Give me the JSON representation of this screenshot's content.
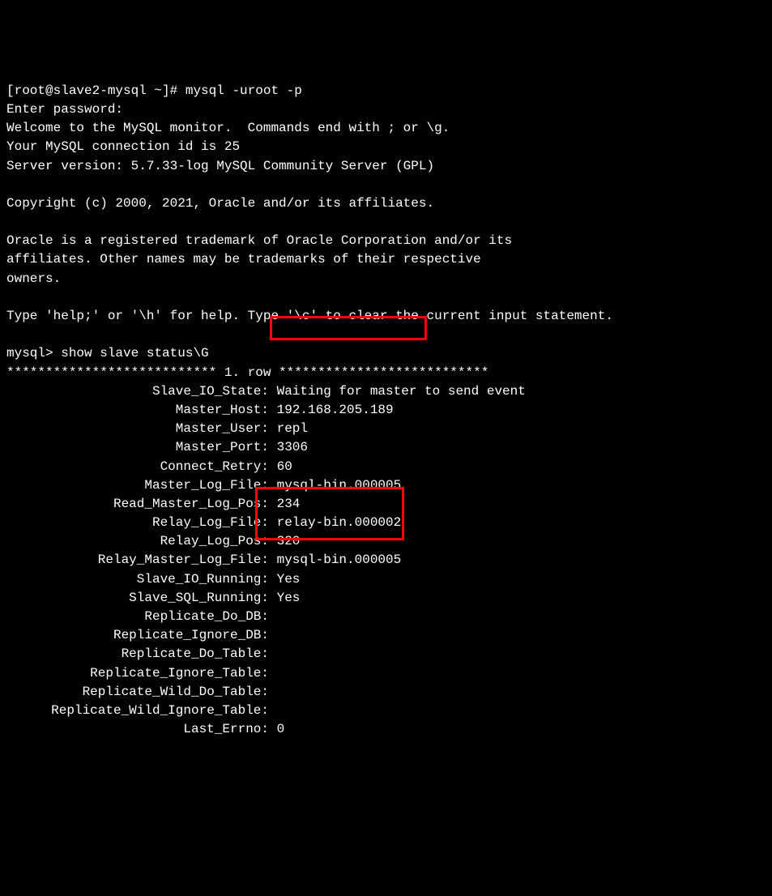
{
  "prompt": "[root@slave2-mysql ~]# ",
  "command": "mysql -uroot -p",
  "intro": {
    "enter_password": "Enter password: ",
    "welcome": "Welcome to the MySQL monitor.  Commands end with ; or \\g.",
    "connection_id": "Your MySQL connection id is 25",
    "server_version": "Server version: 5.7.33-log MySQL Community Server (GPL)",
    "copyright": "Copyright (c) 2000, 2021, Oracle and/or its affiliates.",
    "trademark1": "Oracle is a registered trademark of Oracle Corporation and/or its",
    "trademark2": "affiliates. Other names may be trademarks of their respective",
    "trademark3": "owners.",
    "help": "Type 'help;' or '\\h' for help. Type '\\c' to clear the current input statement."
  },
  "mysql_prompt": "mysql> ",
  "mysql_command": "show slave status\\G",
  "row_header": "*************************** 1. row ***************************",
  "status": {
    "slave_io_state": {
      "label": "Slave_IO_State:",
      "value": " Waiting for master to send event"
    },
    "master_host": {
      "label": "Master_Host:",
      "value": " 192.168.205.189"
    },
    "master_user": {
      "label": "Master_User:",
      "value": " repl"
    },
    "master_port": {
      "label": "Master_Port:",
      "value": " 3306"
    },
    "connect_retry": {
      "label": "Connect_Retry:",
      "value": " 60"
    },
    "master_log_file": {
      "label": "Master_Log_File:",
      "value": " mysql-bin.000005"
    },
    "read_master_log_pos": {
      "label": "Read_Master_Log_Pos:",
      "value": " 234"
    },
    "relay_log_file": {
      "label": "Relay_Log_File:",
      "value": " relay-bin.000002"
    },
    "relay_log_pos": {
      "label": "Relay_Log_Pos:",
      "value": " 320"
    },
    "relay_master_log_file": {
      "label": "Relay_Master_Log_File:",
      "value": " mysql-bin.000005"
    },
    "slave_io_running": {
      "label": "Slave_IO_Running:",
      "value": " Yes"
    },
    "slave_sql_running": {
      "label": "Slave_SQL_Running:",
      "value": " Yes"
    },
    "replicate_do_db": {
      "label": "Replicate_Do_DB:",
      "value": " "
    },
    "replicate_ignore_db": {
      "label": "Replicate_Ignore_DB:",
      "value": " "
    },
    "replicate_do_table": {
      "label": "Replicate_Do_Table:",
      "value": " "
    },
    "replicate_ignore_table": {
      "label": "Replicate_Ignore_Table:",
      "value": " "
    },
    "replicate_wild_do_table": {
      "label": "Replicate_Wild_Do_Table:",
      "value": " "
    },
    "replicate_wild_ignore_table": {
      "label": "Replicate_Wild_Ignore_Table:",
      "value": " "
    },
    "last_errno": {
      "label": "Last_Errno:",
      "value": " 0"
    }
  }
}
